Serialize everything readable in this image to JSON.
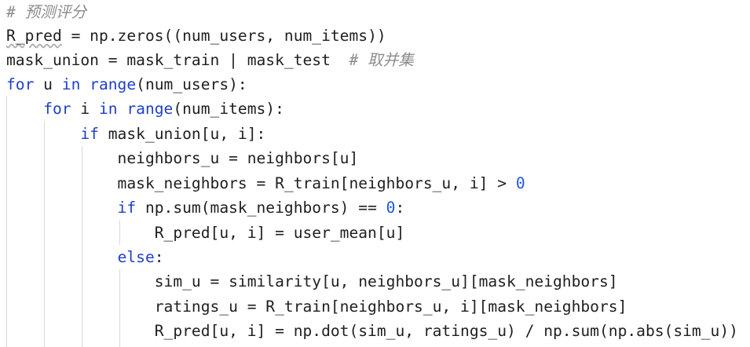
{
  "colors": {
    "background": "#ffffff",
    "text": "#1f1f1f",
    "keyword": "#1f40c8",
    "number": "#1f55e0",
    "comment": "#8c8c8c",
    "indent_guide": "#d9d9d9"
  },
  "code": {
    "lines": [
      [
        {
          "t": "# 预测评分",
          "c": "comment"
        }
      ],
      [
        {
          "t": "R_pred",
          "c": "plain"
        },
        {
          "t": " = np.zeros((num_users, num_items))",
          "c": "plain"
        }
      ],
      [
        {
          "t": "mask_union = mask_train | mask_test  ",
          "c": "plain"
        },
        {
          "t": "# 取并集",
          "c": "comment"
        }
      ],
      [
        {
          "t": "for",
          "c": "keyword"
        },
        {
          "t": " u ",
          "c": "plain"
        },
        {
          "t": "in",
          "c": "keyword"
        },
        {
          "t": " ",
          "c": "plain"
        },
        {
          "t": "range",
          "c": "builtin"
        },
        {
          "t": "(num_users):",
          "c": "plain"
        }
      ],
      [
        {
          "t": "    ",
          "c": "plain"
        },
        {
          "t": "for",
          "c": "keyword"
        },
        {
          "t": " i ",
          "c": "plain"
        },
        {
          "t": "in",
          "c": "keyword"
        },
        {
          "t": " ",
          "c": "plain"
        },
        {
          "t": "range",
          "c": "builtin"
        },
        {
          "t": "(num_items):",
          "c": "plain"
        }
      ],
      [
        {
          "t": "        ",
          "c": "plain"
        },
        {
          "t": "if",
          "c": "keyword"
        },
        {
          "t": " mask_union[u, i]:",
          "c": "plain"
        }
      ],
      [
        {
          "t": "            neighbors_u = neighbors[u]",
          "c": "plain"
        }
      ],
      [
        {
          "t": "            mask_neighbors = R_train[neighbors_u, i] > ",
          "c": "plain"
        },
        {
          "t": "0",
          "c": "number"
        }
      ],
      [
        {
          "t": "            ",
          "c": "plain"
        },
        {
          "t": "if",
          "c": "keyword"
        },
        {
          "t": " np.sum(mask_neighbors) == ",
          "c": "plain"
        },
        {
          "t": "0",
          "c": "number"
        },
        {
          "t": ":",
          "c": "plain"
        }
      ],
      [
        {
          "t": "                R_pred[u, i] = user_mean[u]",
          "c": "plain"
        }
      ],
      [
        {
          "t": "            ",
          "c": "plain"
        },
        {
          "t": "else",
          "c": "keyword"
        },
        {
          "t": ":",
          "c": "plain"
        }
      ],
      [
        {
          "t": "                sim_u = similarity[u, neighbors_u][mask_neighbors]",
          "c": "plain"
        }
      ],
      [
        {
          "t": "                ratings_u = R_train[neighbors_u, i][mask_neighbors]",
          "c": "plain"
        }
      ],
      [
        {
          "t": "                R_pred[u, i] = np.dot(sim_u, ratings_u) / np.sum(np.abs(sim_u))",
          "c": "plain"
        }
      ]
    ]
  }
}
